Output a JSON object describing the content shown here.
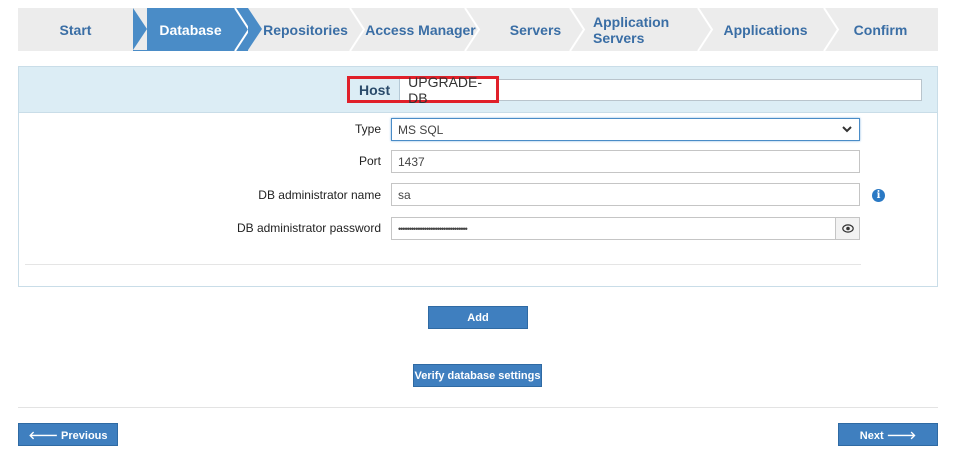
{
  "wizard": {
    "steps": [
      {
        "label": "Start"
      },
      {
        "label": "Database"
      },
      {
        "label": "Repositories"
      },
      {
        "label": "Access Manager"
      },
      {
        "label": "Servers"
      },
      {
        "label": "Application Servers"
      },
      {
        "label": "Applications"
      },
      {
        "label": "Confirm"
      }
    ],
    "active_index": 1
  },
  "form": {
    "host_label": "Host",
    "host_value": "UPGRADE-DB",
    "type_label": "Type",
    "type_value": "MS SQL",
    "port_label": "Port",
    "port_value": "1437",
    "admin_name_label": "DB administrator name",
    "admin_name_value": "sa",
    "admin_password_label": "DB administrator password",
    "admin_password_value": "••••••••••••••••••••••••••••••••"
  },
  "buttons": {
    "add": "Add",
    "verify": "Verify database settings",
    "previous": "🡐 Previous",
    "next": "Next 🡒"
  },
  "icons": {
    "info": "info-icon",
    "eye": "eye-icon",
    "dropdown": "chevron-down-icon"
  },
  "colors": {
    "accent": "#4a8cc7",
    "button": "#3f7fbf",
    "highlight_border": "#e0202a",
    "host_row_bg": "#dcedf5"
  }
}
